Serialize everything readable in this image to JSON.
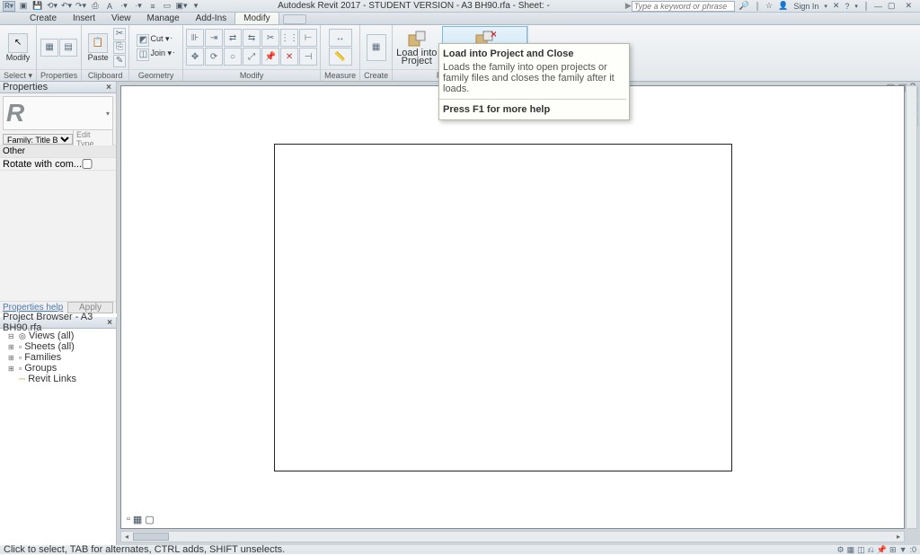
{
  "titlebar": {
    "app_title": "Autodesk Revit 2017 - STUDENT VERSION -     A3 BH90.rfa - Sheet:  -",
    "search_placeholder": "Type a keyword or phrase",
    "signin_label": "Sign In"
  },
  "menubar": {
    "tabs": [
      "Create",
      "Insert",
      "View",
      "Manage",
      "Add-Ins",
      "Modify"
    ],
    "active": 5
  },
  "ribbon": {
    "groups": {
      "select": {
        "label": "Select ▾",
        "btn": "Modify"
      },
      "properties": {
        "label": "Properties"
      },
      "clipboard": {
        "label": "Clipboard",
        "paste": "Paste"
      },
      "geometry": {
        "label": "Geometry",
        "cut": "Cut ▾",
        "join": "Join ▾"
      },
      "modify": {
        "label": "Modify"
      },
      "measure": {
        "label": "Measure"
      },
      "create": {
        "label": "Create"
      },
      "family_editor": {
        "label": "Family Editor",
        "btn1_l1": "Load into",
        "btn1_l2": "Project",
        "btn2_l1": "Load into",
        "btn2_l2": "Project and Close"
      }
    }
  },
  "tooltip": {
    "title": "Load into Project and Close",
    "body": "Loads the family into open projects or family files and closes the family after it loads.",
    "help": "Press F1 for more help"
  },
  "properties": {
    "title": "Properties",
    "family_label": "Family: Title Blocks",
    "edit_type": "Edit Type",
    "section_other": "Other",
    "row1_label": "Rotate with com...",
    "footer_help": "Properties help",
    "footer_apply": "Apply"
  },
  "project_browser": {
    "title": "Project Browser - A3 BH90.rfa",
    "nodes": [
      {
        "exp": "⊟",
        "label": "Views (all)"
      },
      {
        "exp": "⊞",
        "label": "Sheets (all)"
      },
      {
        "exp": "⊞",
        "label": "Families"
      },
      {
        "exp": "⊞",
        "label": "Groups"
      },
      {
        "exp": "",
        "label": "Revit Links"
      }
    ]
  },
  "status": {
    "text": "Click to select, TAB for alternates, CTRL adds, SHIFT unselects.",
    "filter_count": ":0"
  }
}
